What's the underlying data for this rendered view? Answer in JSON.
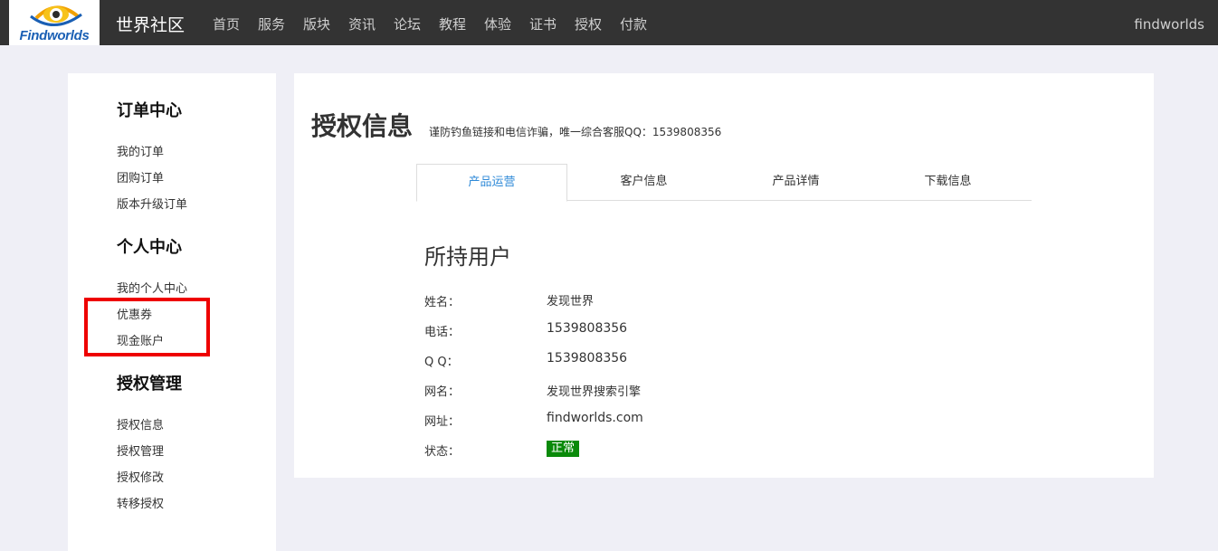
{
  "header": {
    "logo_text": "Findworlds",
    "site_title": "世界社区",
    "nav": [
      "首页",
      "服务",
      "版块",
      "资讯",
      "论坛",
      "教程",
      "体验",
      "证书",
      "授权",
      "付款"
    ],
    "user": "findworlds"
  },
  "sidebar": {
    "groups": [
      {
        "heading": "订单中心",
        "items": [
          "我的订单",
          "团购订单",
          "版本升级订单"
        ]
      },
      {
        "heading": "个人中心",
        "items": [
          "我的个人中心",
          "优惠券",
          "现金账户"
        ]
      },
      {
        "heading": "授权管理",
        "items": [
          "授权信息",
          "授权管理",
          "授权修改",
          "转移授权"
        ]
      }
    ],
    "highlight_color": "#ee0000"
  },
  "main": {
    "title": "授权信息",
    "subtitle": "谨防钓鱼链接和电信诈骗，唯一综合客服QQ：1539808356",
    "tabs": [
      "产品运营",
      "客户信息",
      "产品详情",
      "下载信息"
    ],
    "active_tab": "产品运营",
    "section_title": "所持用户",
    "fields": [
      {
        "label": "姓名：",
        "value": "发现世界"
      },
      {
        "label": "电话：",
        "value": "1539808356"
      },
      {
        "label": "Q Q：",
        "value": "1539808356"
      },
      {
        "label": "网名：",
        "value": "发现世界搜索引擎"
      },
      {
        "label": "网址：",
        "value": "findworlds.com"
      }
    ],
    "status": {
      "label": "状态：",
      "value": "正常",
      "color": "#0a8a0a"
    }
  }
}
